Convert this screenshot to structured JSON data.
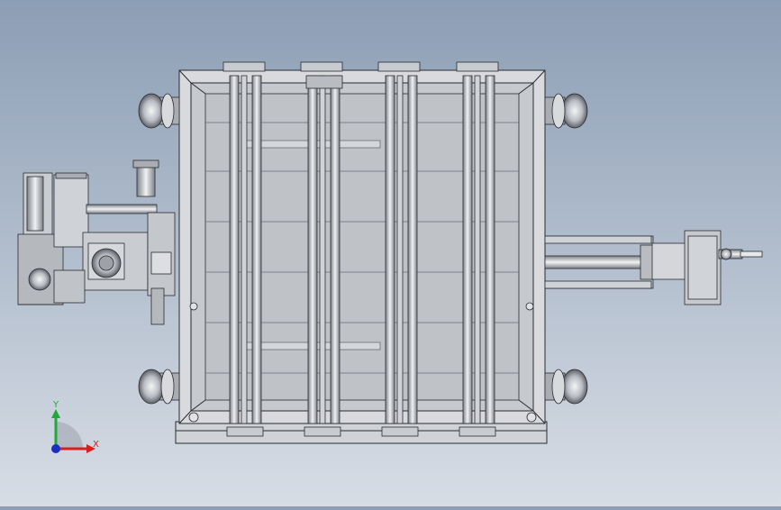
{
  "triad": {
    "x_label": "X",
    "y_label": "Y",
    "colors": {
      "x_axis": "#d62020",
      "y_axis": "#22a83a",
      "z_dot": "#1c2fc4"
    }
  },
  "colors": {
    "background_top": "#8c9eb5",
    "background_bottom": "#d7dde5",
    "metal_light": "#e4e6ea",
    "metal_mid": "#c4c7cc",
    "metal_dark": "#8e9298",
    "outline": "#2a2c30"
  }
}
